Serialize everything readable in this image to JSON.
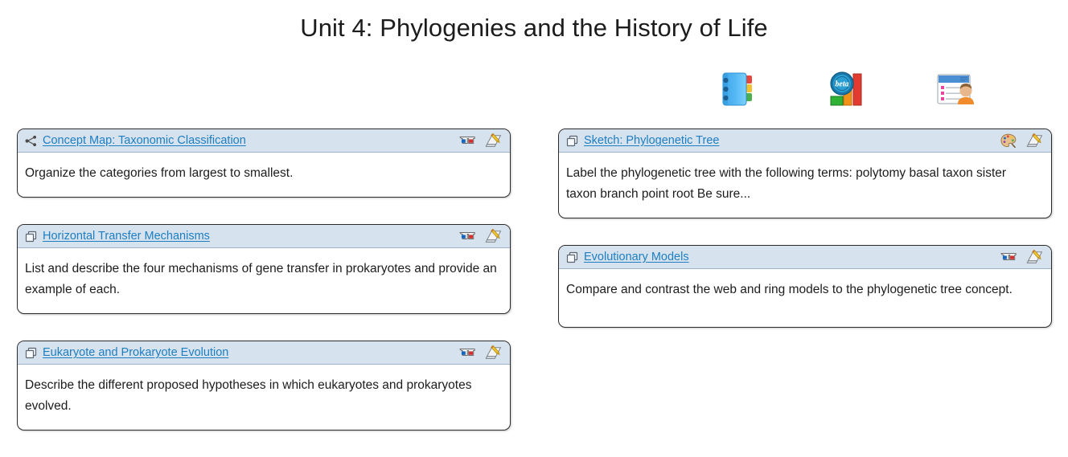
{
  "page": {
    "title": "Unit 4: Phylogenies and the History of Life"
  },
  "toolbar": {
    "icons": [
      {
        "name": "address-book-icon",
        "label": "Notebook"
      },
      {
        "name": "beta-chart-icon",
        "label": "beta"
      },
      {
        "name": "contact-card-icon",
        "label": "Contacts"
      }
    ]
  },
  "columns": {
    "left": [
      {
        "type_icon": "share-nodes-icon",
        "title": "Concept Map: Taxonomic Classification",
        "body": "Organize the categories from largest to smallest.",
        "actions": [
          "3d-glasses-icon",
          "edit-note-icon"
        ],
        "tall": false
      },
      {
        "type_icon": "copy-layers-icon",
        "title": "Horizontal Transfer Mechanisms",
        "body": "List and describe the four mechanisms of gene transfer in prokaryotes and provide an example of each.",
        "actions": [
          "3d-glasses-icon",
          "edit-note-icon"
        ],
        "tall": true
      },
      {
        "type_icon": "copy-layers-icon",
        "title": "Eukaryote and Prokaryote Evolution",
        "body": "Describe the different proposed hypotheses in which eukaryotes and prokaryotes evolved.",
        "actions": [
          "3d-glasses-icon",
          "edit-note-icon"
        ],
        "tall": true
      }
    ],
    "right": [
      {
        "type_icon": "copy-layers-icon",
        "title": "Sketch: Phylogenetic Tree",
        "body": "Label the phylogenetic tree with the following terms: polytomy basal taxon sister taxon branch point  root Be sure...",
        "actions": [
          "palette-icon",
          "edit-note-icon"
        ],
        "tall": true
      },
      {
        "type_icon": "copy-layers-icon",
        "title": "Evolutionary Models",
        "body": "Compare and contrast the web and ring models to the phylogenetic tree concept.",
        "actions": [
          "3d-glasses-icon",
          "edit-note-icon"
        ],
        "tall": true
      }
    ]
  },
  "colors": {
    "link": "#1d7ec2",
    "header_bg": "#d6e3ef",
    "card_border": "#2b2b2b",
    "text": "#1c1c1c"
  }
}
